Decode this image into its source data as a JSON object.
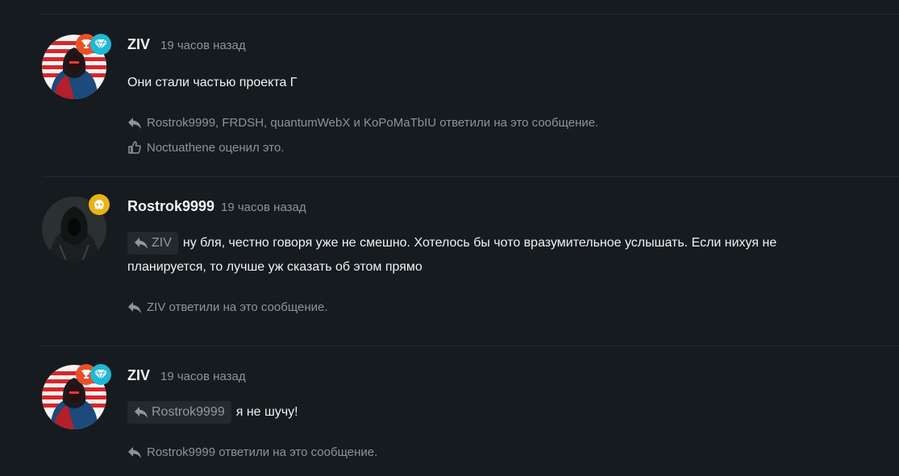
{
  "posts": [
    {
      "author": "ZIV",
      "time": "19 часов назад",
      "text": "Они стали частью проекта Г",
      "replied_line": "Rostrok9999, FRDSH, quantumWebX и KoPoMaTbIU ответили на это сообщение.",
      "liked_line": "Noctuathene оценил это.",
      "badges": [
        "trophy-badge",
        "diamond-badge"
      ]
    },
    {
      "author": "Rostrok9999",
      "time": "19 часов назад",
      "quote_author": "ZIV",
      "text_line1": "ну бля, честно говоря уже не смешно. Хотелось бы чото вразумительное услышать. Если нихуя не",
      "text_line2": "планируется, то лучше уж сказать об этом прямо",
      "replied_line": "ZIV ответили на это сообщение.",
      "badges": [
        "skull-badge"
      ]
    },
    {
      "author": "ZIV",
      "time": "19 часов назад",
      "quote_author": "Rostrok9999",
      "text": "я не шучу!",
      "replied_line": "Rostrok9999 ответили на это сообщение.",
      "badges": [
        "trophy-badge",
        "diamond-badge"
      ]
    }
  ],
  "colors": {
    "background": "#161b1f",
    "muted": "#8a949c",
    "trophy_badge": "#e8502a",
    "diamond_badge": "#1fb8d6",
    "skull_badge": "#e8b417"
  }
}
